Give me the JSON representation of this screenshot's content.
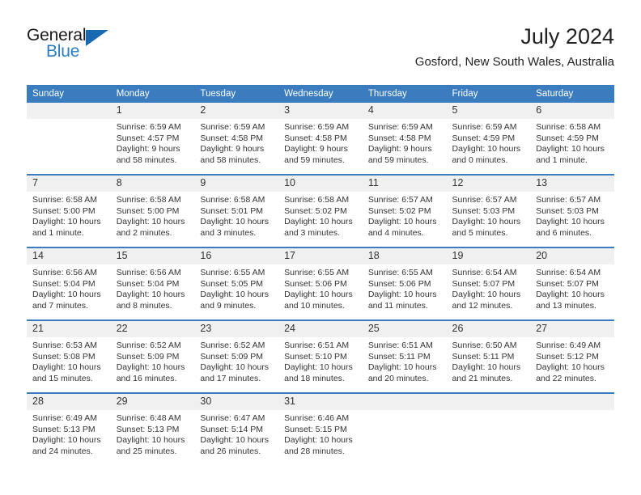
{
  "brand": {
    "name_top": "General",
    "name_bottom": "Blue",
    "accent_color": "#1769b0",
    "blue_text_color": "#2b7cc4"
  },
  "header": {
    "title": "July 2024",
    "subtitle": "Gosford, New South Wales, Australia"
  },
  "theme": {
    "header_blue": "#3a7cbe",
    "daynum_band": "#f0f0f0",
    "text": "#333333"
  },
  "weekday_headers": [
    "Sunday",
    "Monday",
    "Tuesday",
    "Wednesday",
    "Thursday",
    "Friday",
    "Saturday"
  ],
  "labels": {
    "sunrise_prefix": "Sunrise:",
    "sunset_prefix": "Sunset:",
    "daylight_prefix": "Daylight:"
  },
  "weeks": [
    [
      {
        "day": "",
        "sunrise": "",
        "sunset": "",
        "daylight_line1": "",
        "daylight_line2": ""
      },
      {
        "day": "1",
        "sunrise": "Sunrise: 6:59 AM",
        "sunset": "Sunset: 4:57 PM",
        "daylight_line1": "Daylight: 9 hours",
        "daylight_line2": "and 58 minutes."
      },
      {
        "day": "2",
        "sunrise": "Sunrise: 6:59 AM",
        "sunset": "Sunset: 4:58 PM",
        "daylight_line1": "Daylight: 9 hours",
        "daylight_line2": "and 58 minutes."
      },
      {
        "day": "3",
        "sunrise": "Sunrise: 6:59 AM",
        "sunset": "Sunset: 4:58 PM",
        "daylight_line1": "Daylight: 9 hours",
        "daylight_line2": "and 59 minutes."
      },
      {
        "day": "4",
        "sunrise": "Sunrise: 6:59 AM",
        "sunset": "Sunset: 4:58 PM",
        "daylight_line1": "Daylight: 9 hours",
        "daylight_line2": "and 59 minutes."
      },
      {
        "day": "5",
        "sunrise": "Sunrise: 6:59 AM",
        "sunset": "Sunset: 4:59 PM",
        "daylight_line1": "Daylight: 10 hours",
        "daylight_line2": "and 0 minutes."
      },
      {
        "day": "6",
        "sunrise": "Sunrise: 6:58 AM",
        "sunset": "Sunset: 4:59 PM",
        "daylight_line1": "Daylight: 10 hours",
        "daylight_line2": "and 1 minute."
      }
    ],
    [
      {
        "day": "7",
        "sunrise": "Sunrise: 6:58 AM",
        "sunset": "Sunset: 5:00 PM",
        "daylight_line1": "Daylight: 10 hours",
        "daylight_line2": "and 1 minute."
      },
      {
        "day": "8",
        "sunrise": "Sunrise: 6:58 AM",
        "sunset": "Sunset: 5:00 PM",
        "daylight_line1": "Daylight: 10 hours",
        "daylight_line2": "and 2 minutes."
      },
      {
        "day": "9",
        "sunrise": "Sunrise: 6:58 AM",
        "sunset": "Sunset: 5:01 PM",
        "daylight_line1": "Daylight: 10 hours",
        "daylight_line2": "and 3 minutes."
      },
      {
        "day": "10",
        "sunrise": "Sunrise: 6:58 AM",
        "sunset": "Sunset: 5:02 PM",
        "daylight_line1": "Daylight: 10 hours",
        "daylight_line2": "and 3 minutes."
      },
      {
        "day": "11",
        "sunrise": "Sunrise: 6:57 AM",
        "sunset": "Sunset: 5:02 PM",
        "daylight_line1": "Daylight: 10 hours",
        "daylight_line2": "and 4 minutes."
      },
      {
        "day": "12",
        "sunrise": "Sunrise: 6:57 AM",
        "sunset": "Sunset: 5:03 PM",
        "daylight_line1": "Daylight: 10 hours",
        "daylight_line2": "and 5 minutes."
      },
      {
        "day": "13",
        "sunrise": "Sunrise: 6:57 AM",
        "sunset": "Sunset: 5:03 PM",
        "daylight_line1": "Daylight: 10 hours",
        "daylight_line2": "and 6 minutes."
      }
    ],
    [
      {
        "day": "14",
        "sunrise": "Sunrise: 6:56 AM",
        "sunset": "Sunset: 5:04 PM",
        "daylight_line1": "Daylight: 10 hours",
        "daylight_line2": "and 7 minutes."
      },
      {
        "day": "15",
        "sunrise": "Sunrise: 6:56 AM",
        "sunset": "Sunset: 5:04 PM",
        "daylight_line1": "Daylight: 10 hours",
        "daylight_line2": "and 8 minutes."
      },
      {
        "day": "16",
        "sunrise": "Sunrise: 6:55 AM",
        "sunset": "Sunset: 5:05 PM",
        "daylight_line1": "Daylight: 10 hours",
        "daylight_line2": "and 9 minutes."
      },
      {
        "day": "17",
        "sunrise": "Sunrise: 6:55 AM",
        "sunset": "Sunset: 5:06 PM",
        "daylight_line1": "Daylight: 10 hours",
        "daylight_line2": "and 10 minutes."
      },
      {
        "day": "18",
        "sunrise": "Sunrise: 6:55 AM",
        "sunset": "Sunset: 5:06 PM",
        "daylight_line1": "Daylight: 10 hours",
        "daylight_line2": "and 11 minutes."
      },
      {
        "day": "19",
        "sunrise": "Sunrise: 6:54 AM",
        "sunset": "Sunset: 5:07 PM",
        "daylight_line1": "Daylight: 10 hours",
        "daylight_line2": "and 12 minutes."
      },
      {
        "day": "20",
        "sunrise": "Sunrise: 6:54 AM",
        "sunset": "Sunset: 5:07 PM",
        "daylight_line1": "Daylight: 10 hours",
        "daylight_line2": "and 13 minutes."
      }
    ],
    [
      {
        "day": "21",
        "sunrise": "Sunrise: 6:53 AM",
        "sunset": "Sunset: 5:08 PM",
        "daylight_line1": "Daylight: 10 hours",
        "daylight_line2": "and 15 minutes."
      },
      {
        "day": "22",
        "sunrise": "Sunrise: 6:52 AM",
        "sunset": "Sunset: 5:09 PM",
        "daylight_line1": "Daylight: 10 hours",
        "daylight_line2": "and 16 minutes."
      },
      {
        "day": "23",
        "sunrise": "Sunrise: 6:52 AM",
        "sunset": "Sunset: 5:09 PM",
        "daylight_line1": "Daylight: 10 hours",
        "daylight_line2": "and 17 minutes."
      },
      {
        "day": "24",
        "sunrise": "Sunrise: 6:51 AM",
        "sunset": "Sunset: 5:10 PM",
        "daylight_line1": "Daylight: 10 hours",
        "daylight_line2": "and 18 minutes."
      },
      {
        "day": "25",
        "sunrise": "Sunrise: 6:51 AM",
        "sunset": "Sunset: 5:11 PM",
        "daylight_line1": "Daylight: 10 hours",
        "daylight_line2": "and 20 minutes."
      },
      {
        "day": "26",
        "sunrise": "Sunrise: 6:50 AM",
        "sunset": "Sunset: 5:11 PM",
        "daylight_line1": "Daylight: 10 hours",
        "daylight_line2": "and 21 minutes."
      },
      {
        "day": "27",
        "sunrise": "Sunrise: 6:49 AM",
        "sunset": "Sunset: 5:12 PM",
        "daylight_line1": "Daylight: 10 hours",
        "daylight_line2": "and 22 minutes."
      }
    ],
    [
      {
        "day": "28",
        "sunrise": "Sunrise: 6:49 AM",
        "sunset": "Sunset: 5:13 PM",
        "daylight_line1": "Daylight: 10 hours",
        "daylight_line2": "and 24 minutes."
      },
      {
        "day": "29",
        "sunrise": "Sunrise: 6:48 AM",
        "sunset": "Sunset: 5:13 PM",
        "daylight_line1": "Daylight: 10 hours",
        "daylight_line2": "and 25 minutes."
      },
      {
        "day": "30",
        "sunrise": "Sunrise: 6:47 AM",
        "sunset": "Sunset: 5:14 PM",
        "daylight_line1": "Daylight: 10 hours",
        "daylight_line2": "and 26 minutes."
      },
      {
        "day": "31",
        "sunrise": "Sunrise: 6:46 AM",
        "sunset": "Sunset: 5:15 PM",
        "daylight_line1": "Daylight: 10 hours",
        "daylight_line2": "and 28 minutes."
      },
      {
        "day": "",
        "sunrise": "",
        "sunset": "",
        "daylight_line1": "",
        "daylight_line2": ""
      },
      {
        "day": "",
        "sunrise": "",
        "sunset": "",
        "daylight_line1": "",
        "daylight_line2": ""
      },
      {
        "day": "",
        "sunrise": "",
        "sunset": "",
        "daylight_line1": "",
        "daylight_line2": ""
      }
    ]
  ]
}
